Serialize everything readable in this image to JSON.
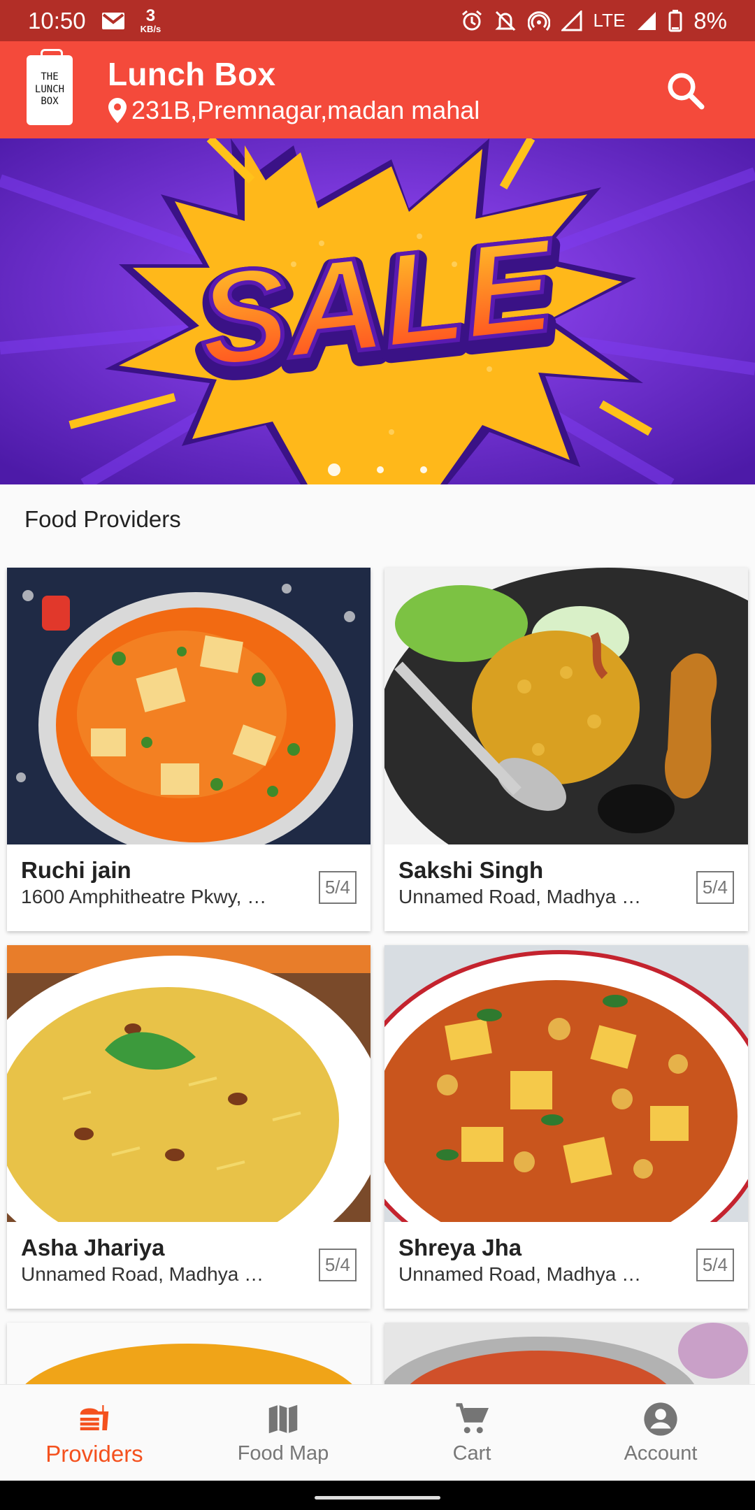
{
  "status_bar": {
    "time": "10:50",
    "speed_value": "3",
    "speed_unit": "KB/s",
    "network": "LTE",
    "battery": "8%"
  },
  "app_bar": {
    "logo_lines": [
      "THE",
      "LUNCH",
      "BOX"
    ],
    "title": "Lunch Box",
    "address": "231B,Premnagar,madan mahal"
  },
  "banner": {
    "text": "SALE",
    "slides": 3,
    "active_slide": 1
  },
  "section_title": "Food Providers",
  "providers": [
    {
      "name": "Ruchi jain",
      "address": "1600 Amphitheatre Pkwy, …",
      "rating": "5/4"
    },
    {
      "name": "Sakshi Singh",
      "address": "Unnamed Road, Madhya …",
      "rating": "5/4"
    },
    {
      "name": "Asha Jhariya",
      "address": "Unnamed Road, Madhya …",
      "rating": "5/4"
    },
    {
      "name": "Shreya Jha",
      "address": "Unnamed Road, Madhya …",
      "rating": "5/4"
    }
  ],
  "bottom_nav": [
    {
      "label": "Providers",
      "icon": "providers-icon",
      "active": true
    },
    {
      "label": "Food Map",
      "icon": "map-icon",
      "active": false
    },
    {
      "label": "Cart",
      "icon": "cart-icon",
      "active": false
    },
    {
      "label": "Account",
      "icon": "account-icon",
      "active": false
    }
  ],
  "colors": {
    "app_bar": "#f44a3b",
    "status_bar": "#b22e27",
    "accent": "#f4511e",
    "banner_bg": "#6b2bc7",
    "banner_burst": "#ffc21a"
  }
}
